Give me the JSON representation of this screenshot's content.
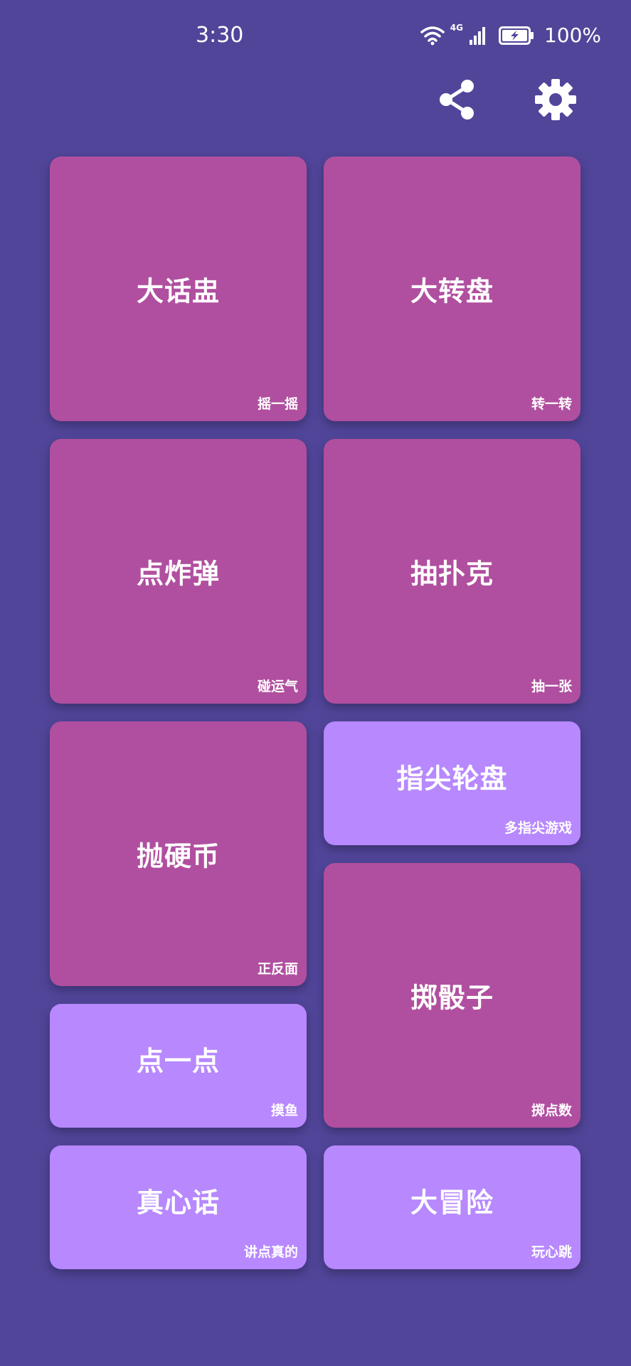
{
  "status_bar": {
    "time": "3:30",
    "network": "4G",
    "battery": "100%"
  },
  "toolbar": {
    "share_icon": "share-icon",
    "settings_icon": "gear-icon"
  },
  "colors": {
    "background": "#51459a",
    "card_primary": "#b04f9f",
    "card_secondary": "#b788fe"
  },
  "cards": [
    {
      "title": "大话盅",
      "subtitle": "摇一摇"
    },
    {
      "title": "大转盘",
      "subtitle": "转一转"
    },
    {
      "title": "点炸弹",
      "subtitle": "碰运气"
    },
    {
      "title": "抽扑克",
      "subtitle": "抽一张"
    },
    {
      "title": "抛硬币",
      "subtitle": "正反面"
    },
    {
      "title": "指尖轮盘",
      "subtitle": "多指尖游戏"
    },
    {
      "title": "点一点",
      "subtitle": "摸鱼"
    },
    {
      "title": "掷骰子",
      "subtitle": "掷点数"
    },
    {
      "title": "真心话",
      "subtitle": "讲点真的"
    },
    {
      "title": "大冒险",
      "subtitle": "玩心跳"
    }
  ]
}
